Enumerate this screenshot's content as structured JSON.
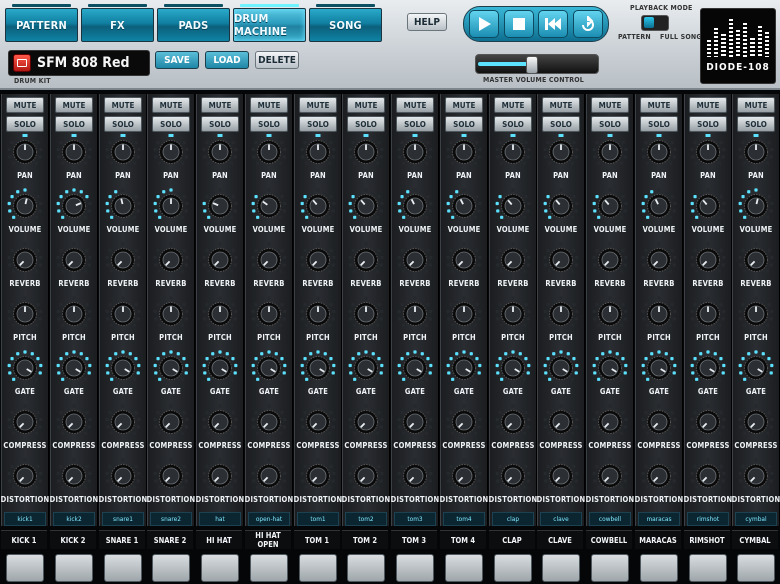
{
  "tabs": [
    {
      "label": "PATTERN",
      "active": false
    },
    {
      "label": "FX",
      "active": false
    },
    {
      "label": "PADS",
      "active": false
    },
    {
      "label": "DRUM MACHINE",
      "active": true
    },
    {
      "label": "SONG",
      "active": false
    }
  ],
  "header": {
    "help_label": "HELP",
    "drumkit_name": "SFM 808 Red",
    "drumkit_caption": "DRUM KIT",
    "save_label": "SAVE",
    "load_label": "LOAD",
    "delete_label": "DELETE",
    "playback_mode_label": "PLAYBACK MODE",
    "pattern_label": "PATTERN",
    "full_song_label": "FULL SONG",
    "master_volume_label": "MASTER VOLUME CONTROL",
    "master_volume_level": 0.45,
    "logo_text": "DIODE-108"
  },
  "transport": {
    "play_icon": "play-icon",
    "stop_icon": "stop-icon",
    "rewind_icon": "rewind-icon",
    "loop_icon": "loop-icon"
  },
  "colors": {
    "accent": "#2aa9c9",
    "led": "#5ce1ff",
    "panel": "#1b1d20"
  },
  "channel_labels": {
    "mute": "MUTE",
    "solo": "SOLO",
    "knobs": [
      "PAN",
      "VOLUME",
      "REVERB",
      "PITCH",
      "GATE",
      "COMPRESS",
      "DISTORTION"
    ]
  },
  "channels": [
    {
      "sample": "kick1",
      "name": "KICK 1",
      "pan": 0.5,
      "volume": 0.55,
      "reverb": 0.0,
      "pitch": 0.5,
      "gate": 0.95,
      "compress": 0.0,
      "distortion": 0.0
    },
    {
      "sample": "kick2",
      "name": "KICK 2",
      "pan": 0.5,
      "volume": 0.75,
      "reverb": 0.0,
      "pitch": 0.5,
      "gate": 0.95,
      "compress": 0.0,
      "distortion": 0.0
    },
    {
      "sample": "snare1",
      "name": "SNARE 1",
      "pan": 0.5,
      "volume": 0.45,
      "reverb": 0.0,
      "pitch": 0.5,
      "gate": 0.95,
      "compress": 0.0,
      "distortion": 0.0
    },
    {
      "sample": "snare2",
      "name": "SNARE 2",
      "pan": 0.5,
      "volume": 0.5,
      "reverb": 0.0,
      "pitch": 0.5,
      "gate": 0.95,
      "compress": 0.0,
      "distortion": 0.0
    },
    {
      "sample": "hat",
      "name": "HI HAT",
      "pan": 0.5,
      "volume": 0.25,
      "reverb": 0.0,
      "pitch": 0.5,
      "gate": 0.95,
      "compress": 0.0,
      "distortion": 0.0
    },
    {
      "sample": "open-hat",
      "name": "HI HAT OPEN",
      "pan": 0.5,
      "volume": 0.3,
      "reverb": 0.0,
      "pitch": 0.5,
      "gate": 0.95,
      "compress": 0.0,
      "distortion": 0.0
    },
    {
      "sample": "tom1",
      "name": "TOM 1",
      "pan": 0.5,
      "volume": 0.35,
      "reverb": 0.0,
      "pitch": 0.5,
      "gate": 0.95,
      "compress": 0.0,
      "distortion": 0.0
    },
    {
      "sample": "tom2",
      "name": "TOM 2",
      "pan": 0.5,
      "volume": 0.35,
      "reverb": 0.0,
      "pitch": 0.5,
      "gate": 0.95,
      "compress": 0.0,
      "distortion": 0.0
    },
    {
      "sample": "tom3",
      "name": "TOM 3",
      "pan": 0.5,
      "volume": 0.4,
      "reverb": 0.0,
      "pitch": 0.5,
      "gate": 0.95,
      "compress": 0.0,
      "distortion": 0.0
    },
    {
      "sample": "tom4",
      "name": "TOM 4",
      "pan": 0.5,
      "volume": 0.4,
      "reverb": 0.0,
      "pitch": 0.5,
      "gate": 0.95,
      "compress": 0.0,
      "distortion": 0.0
    },
    {
      "sample": "clap",
      "name": "CLAP",
      "pan": 0.5,
      "volume": 0.35,
      "reverb": 0.0,
      "pitch": 0.5,
      "gate": 0.95,
      "compress": 0.0,
      "distortion": 0.0
    },
    {
      "sample": "clave",
      "name": "CLAVE",
      "pan": 0.5,
      "volume": 0.35,
      "reverb": 0.0,
      "pitch": 0.5,
      "gate": 0.95,
      "compress": 0.0,
      "distortion": 0.0
    },
    {
      "sample": "cowbell",
      "name": "COWBELL",
      "pan": 0.5,
      "volume": 0.35,
      "reverb": 0.0,
      "pitch": 0.5,
      "gate": 0.95,
      "compress": 0.0,
      "distortion": 0.0
    },
    {
      "sample": "maracas",
      "name": "MARACAS",
      "pan": 0.5,
      "volume": 0.4,
      "reverb": 0.0,
      "pitch": 0.5,
      "gate": 0.95,
      "compress": 0.0,
      "distortion": 0.0
    },
    {
      "sample": "rimshot",
      "name": "RIMSHOT",
      "pan": 0.5,
      "volume": 0.35,
      "reverb": 0.0,
      "pitch": 0.5,
      "gate": 0.95,
      "compress": 0.0,
      "distortion": 0.0
    },
    {
      "sample": "cymbal",
      "name": "CYMBAL",
      "pan": 0.5,
      "volume": 0.55,
      "reverb": 0.0,
      "pitch": 0.5,
      "gate": 0.95,
      "compress": 0.0,
      "distortion": 0.0
    }
  ]
}
